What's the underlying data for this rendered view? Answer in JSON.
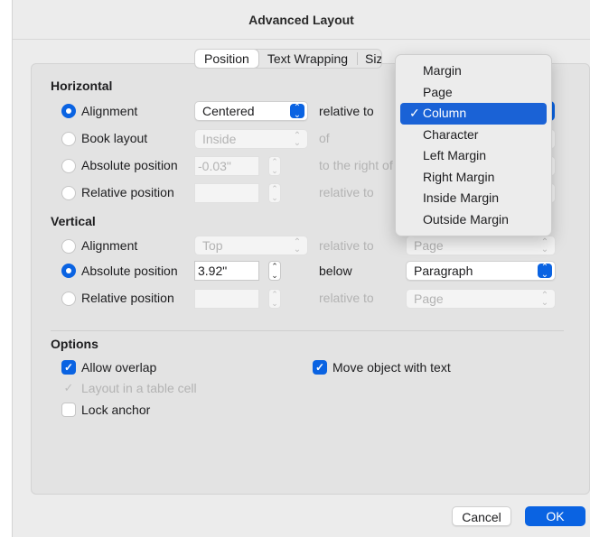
{
  "window": {
    "title": "Advanced Layout"
  },
  "tabs": [
    {
      "label": "Position",
      "selected": true
    },
    {
      "label": "Text Wrapping",
      "selected": false
    },
    {
      "label": "Size",
      "selected": false
    }
  ],
  "horizontal": {
    "heading": "Horizontal",
    "alignment": {
      "label": "Alignment",
      "value": "Centered",
      "relation": "relative to"
    },
    "book_layout": {
      "label": "Book layout",
      "value": "Inside",
      "relation": "of"
    },
    "absolute_position": {
      "label": "Absolute position",
      "value": "-0.03\"",
      "relation": "to the right of"
    },
    "relative_position": {
      "label": "Relative position",
      "value": "",
      "relation": "relative to"
    }
  },
  "vertical": {
    "heading": "Vertical",
    "alignment": {
      "label": "Alignment",
      "value": "Top",
      "relation": "relative to",
      "target": "Page"
    },
    "absolute_position": {
      "label": "Absolute position",
      "value": "3.92\"",
      "relation": "below",
      "target": "Paragraph"
    },
    "relative_position": {
      "label": "Relative position",
      "value": "",
      "relation": "relative to",
      "target": "Page"
    }
  },
  "options": {
    "heading": "Options",
    "allow_overlap": "Allow overlap",
    "layout_in_table_cell": "Layout in a table cell",
    "lock_anchor": "Lock anchor",
    "move_with_text": "Move object with text"
  },
  "dropdown_menu": {
    "items": [
      "Margin",
      "Page",
      "Column",
      "Character",
      "Left Margin",
      "Right Margin",
      "Inside Margin",
      "Outside Margin"
    ],
    "selected_index": 2,
    "check": "✓"
  },
  "buttons": {
    "cancel": "Cancel",
    "ok": "OK"
  },
  "colors": {
    "accent": "#0a63e2",
    "menu_highlight": "#1a62d6"
  }
}
